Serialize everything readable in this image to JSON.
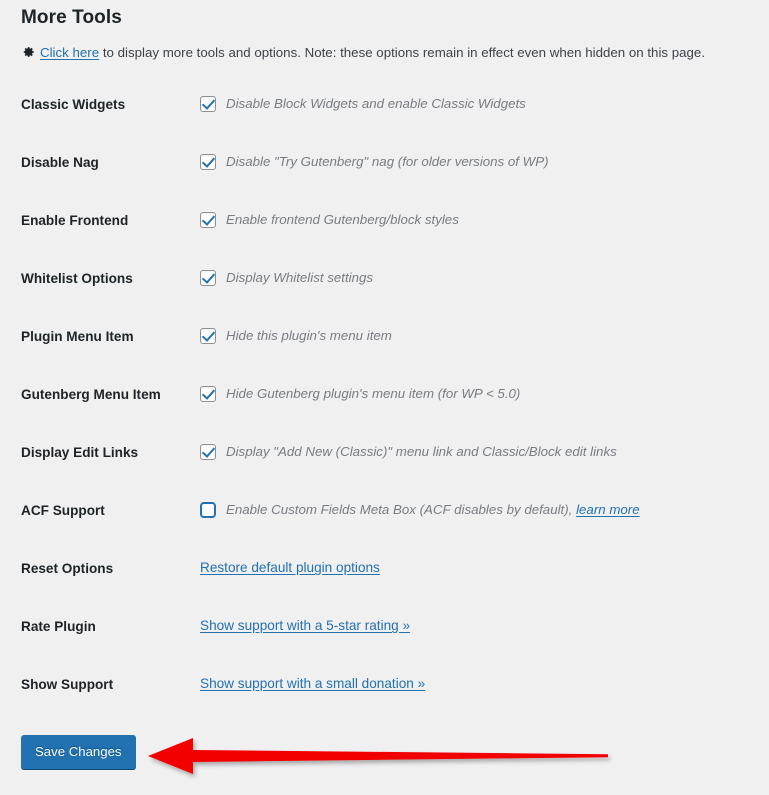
{
  "page": {
    "title": "More Tools",
    "background_color": "#f0f0f1"
  },
  "intro": {
    "icon": "gear-icon",
    "link_label": "Click here",
    "text": " to display more tools and options. Note: these options remain in effect even when hidden on this page."
  },
  "rows": [
    {
      "label": "Classic Widgets",
      "type": "checkbox",
      "checked": true,
      "focused": false,
      "description": "Disable Block Widgets and enable Classic Widgets"
    },
    {
      "label": "Disable Nag",
      "type": "checkbox",
      "checked": true,
      "focused": false,
      "description": "Disable \"Try Gutenberg\" nag (for older versions of WP)"
    },
    {
      "label": "Enable Frontend",
      "type": "checkbox",
      "checked": true,
      "focused": false,
      "description": "Enable frontend Gutenberg/block styles"
    },
    {
      "label": "Whitelist Options",
      "type": "checkbox",
      "checked": true,
      "focused": false,
      "description": "Display Whitelist settings"
    },
    {
      "label": "Plugin Menu Item",
      "type": "checkbox",
      "checked": true,
      "focused": false,
      "description": "Hide this plugin's menu item"
    },
    {
      "label": "Gutenberg Menu Item",
      "type": "checkbox",
      "checked": true,
      "focused": false,
      "description": "Hide Gutenberg plugin's menu item (for WP < 5.0)"
    },
    {
      "label": "Display Edit Links",
      "type": "checkbox",
      "checked": true,
      "focused": false,
      "description": "Display \"Add New (Classic)\" menu link and Classic/Block edit links"
    },
    {
      "label": "ACF Support",
      "type": "checkbox",
      "checked": false,
      "focused": true,
      "description": "Enable Custom Fields Meta Box (ACF disables by default), ",
      "description_link": "learn more"
    },
    {
      "label": "Reset Options",
      "type": "link",
      "link_label": "Restore default plugin options"
    },
    {
      "label": "Rate Plugin",
      "type": "link",
      "link_label": "Show support with a 5-star rating »"
    },
    {
      "label": "Show Support",
      "type": "link",
      "link_label": "Show support with a small donation »"
    }
  ],
  "submit": {
    "save_label": "Save Changes",
    "button_color": "#2271b1"
  },
  "annotation": {
    "type": "arrow",
    "direction": "left",
    "color": "#f20000",
    "points_to": "Save Changes"
  },
  "colors": {
    "link": "#2271b1",
    "label": "#1d2327",
    "description": "#787c82",
    "arrow": "#f20000"
  }
}
